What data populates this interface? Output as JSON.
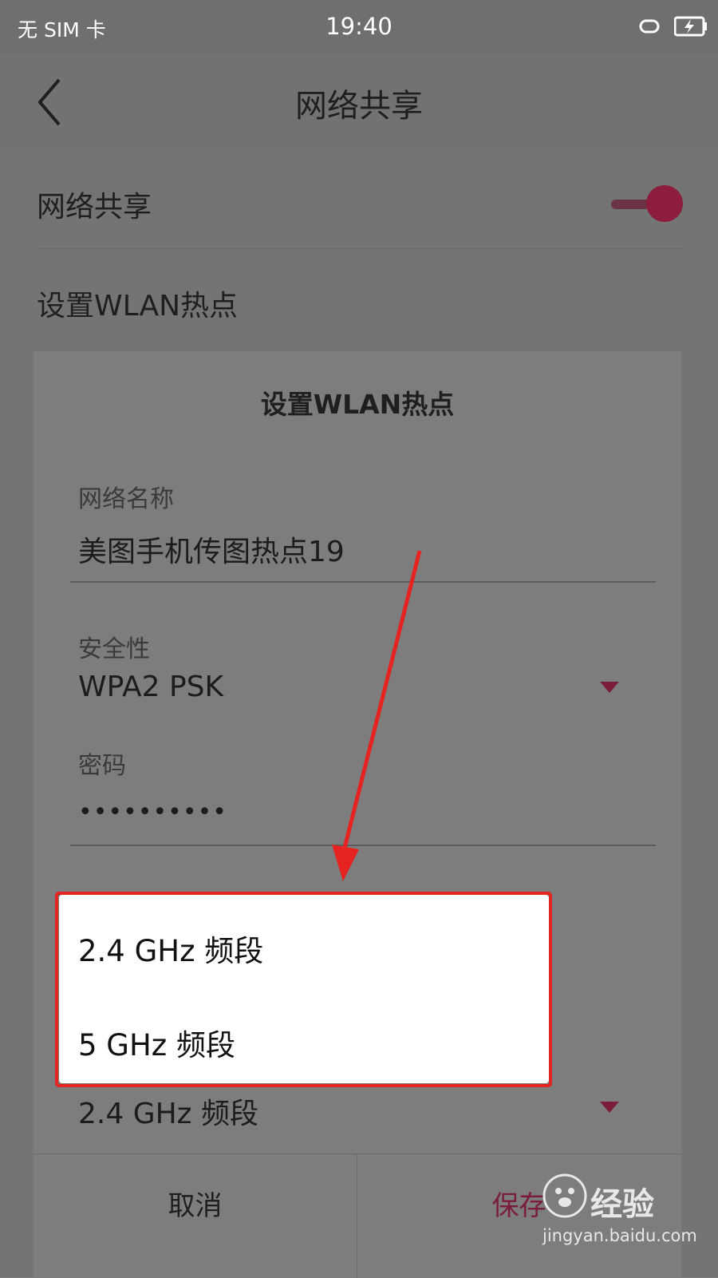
{
  "status_bar": {
    "carrier": "无 SIM 卡",
    "time": "19:40"
  },
  "header": {
    "title": "网络共享"
  },
  "settings": {
    "share_label": "网络共享",
    "hotspot_label": "设置WLAN热点"
  },
  "dialog": {
    "title": "设置WLAN热点",
    "network_name_label": "网络名称",
    "network_name_value": "美图手机传图热点19",
    "security_label": "安全性",
    "security_value": "WPA2 PSK",
    "password_label": "密码",
    "password_value": "••••••••••",
    "band_value": "2.4 GHz 频段",
    "cancel_label": "取消",
    "save_label": "保存"
  },
  "band_menu": {
    "options": [
      "2.4 GHz 频段",
      "5 GHz 频段"
    ]
  },
  "watermark": {
    "brand": "经验",
    "url": "jingyan.baidu.com"
  },
  "colors": {
    "accent": "#8c1d3d",
    "annotation": "#e52421"
  }
}
